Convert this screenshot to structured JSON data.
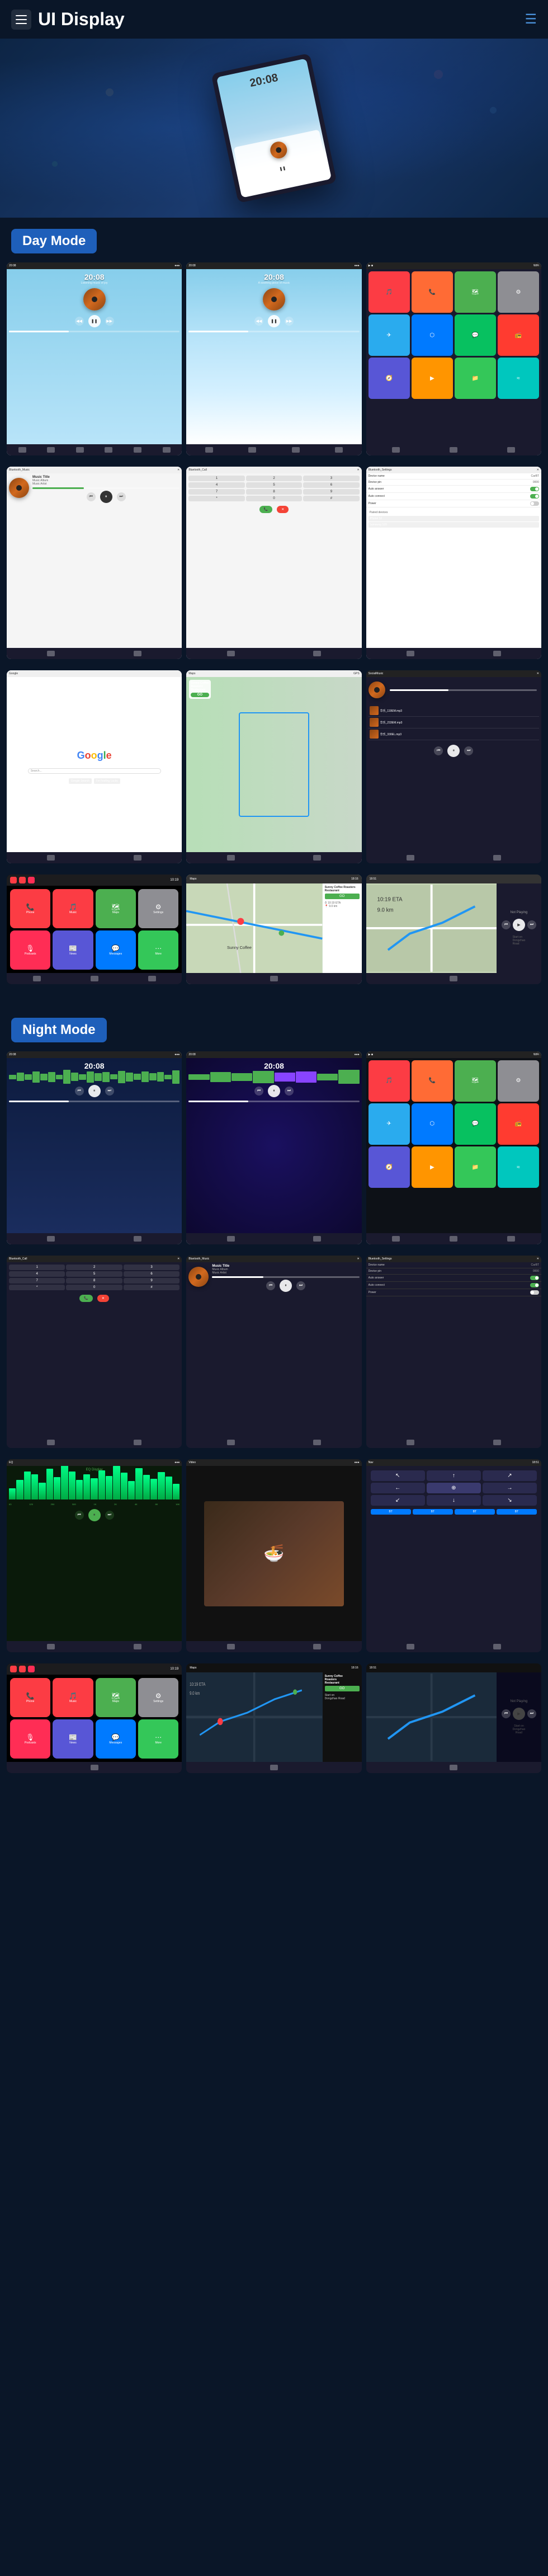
{
  "header": {
    "title": "UI Display",
    "menu_label": "menu",
    "nav_icon": "≡"
  },
  "day_mode": {
    "label": "Day Mode"
  },
  "night_mode": {
    "label": "Night Mode"
  },
  "screens": {
    "time": "20:08",
    "music_title": "Music Title",
    "music_album": "Music Album",
    "music_artist": "Music Artist",
    "bluetooth_music": "Bluetooth_Music",
    "bluetooth_call": "Bluetooth_Call",
    "bluetooth_settings": "Bluetooth_Settings",
    "google": "Google",
    "device_name_label": "Device name",
    "device_name_val": "CarBT",
    "device_pin_label": "Device pin",
    "device_pin_val": "0000",
    "auto_answer": "Auto answer",
    "auto_connect": "Auto connect",
    "power": "Power",
    "social_music": "SocialMusic",
    "not_playing": "Not Playing",
    "sunny_coffee": "Sunny Coffee\nRoasters\nRestaurant",
    "go_btn": "GO",
    "start_on": "Start on\nDongzhao\nRoad",
    "eta": "10:19 ETA",
    "dist": "9.0 km",
    "eq_title": "EQ Display",
    "song1": "华乐_119EM.mp3",
    "song2": "华乐_233EM.mp3",
    "song3": "华乐_330EL.mp3"
  },
  "app_colors": {
    "phone": "#4CAF50",
    "music": "#FC3C44",
    "maps": "#4CAF50",
    "settings": "#8E8E93",
    "telegram": "#2AABEE",
    "bluetooth": "#007AFF",
    "wechat": "#07C160",
    "calendar": "#FC3C44"
  },
  "wave_heights": [
    8,
    15,
    10,
    20,
    12,
    18,
    8,
    25,
    15,
    10,
    20,
    14,
    18,
    9,
    22,
    16,
    11,
    19,
    13,
    17,
    8,
    24
  ],
  "eq_heights": [
    20,
    35,
    50,
    45,
    30,
    55,
    40,
    65,
    50,
    35,
    45,
    38,
    52,
    42,
    60,
    48,
    33,
    56,
    44,
    37,
    49,
    41,
    28
  ]
}
